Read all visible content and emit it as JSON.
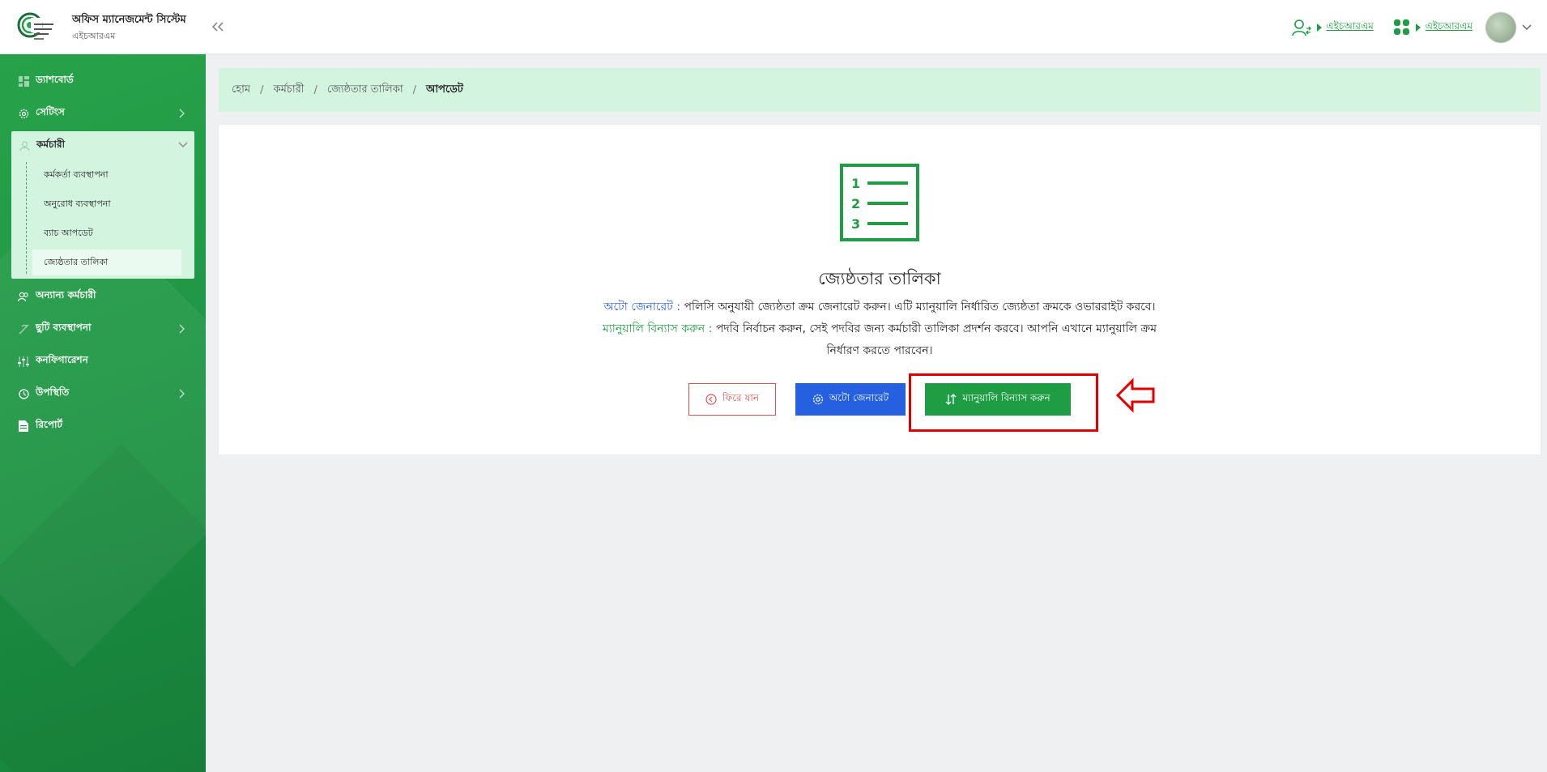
{
  "header": {
    "app_title": "অফিস ম্যানেজমেন্ট সিস্টেম",
    "app_subtitle": "এইচআরএম",
    "user_link": "এইচআরএম",
    "apps_link": "এইচআরএম"
  },
  "sidebar": {
    "items": [
      {
        "label": "ড্যাশবোর্ড",
        "icon": "dashboard-icon"
      },
      {
        "label": "সেটিংস",
        "icon": "gear-icon"
      },
      {
        "label": "কর্মচারী",
        "icon": "users-icon"
      },
      {
        "label": "অন্যান্য কর্মচারী",
        "icon": "users-icon"
      },
      {
        "label": "ছুটি ব্যবস্থাপনা",
        "icon": "leave-icon"
      },
      {
        "label": "কনফিগারেশন",
        "icon": "sliders-icon"
      },
      {
        "label": "উপস্থিতি",
        "icon": "clock-icon"
      },
      {
        "label": "রিপোর্ট",
        "icon": "document-icon"
      }
    ],
    "employee_subitems": [
      "কর্মকর্তা ব্যবস্থাপনা",
      "অনুরোধ ব্যবস্থাপনা",
      "ব্যাচ আপডেট",
      "জ্যেষ্ঠতার তালিকা"
    ]
  },
  "breadcrumb": {
    "home": "হোম",
    "employee": "কর্মচারী",
    "seniority": "জ্যেষ্ঠতার তালিকা",
    "current": "আপডেট"
  },
  "card": {
    "title": "জ্যেষ্ঠতার তালিকা",
    "auto_label": "অটো জেনারেট :",
    "auto_text": "পলিসি অনুযায়ী জ্যেষ্ঠতা ক্রম জেনারেট করুন। এটি ম্যানুয়ালি নির্ধারিত জ্যেষ্ঠতা ক্রমকে ওভাররাইট করবে।",
    "manual_label": "ম্যানুয়ালি বিন্যাস করুন :",
    "manual_text_line1": "পদবি নির্বাচন করুন, সেই পদবির জন্য কর্মচারী তালিকা প্রদর্শন করবে। আপনি এখানে ম্যানুয়ালি ক্রম",
    "manual_text_line2": "নির্ধারণ করতে পারবেন।",
    "back_button": "ফিরে যান",
    "auto_button": "অটো জেনারেট",
    "manual_button": "ম্যানুয়ালি বিন্যাস করুন"
  },
  "colors": {
    "brand_green": "#1f9d45",
    "sidebar_green": "#27a24a",
    "highlight_green": "#d3f5e0",
    "auto_blue": "#2460e0",
    "back_red": "#e05050",
    "annotation_red": "#e10000"
  }
}
